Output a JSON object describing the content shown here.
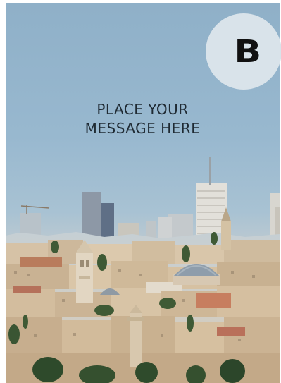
{
  "card": {
    "message_line1": "PLACE YOUR",
    "message_line2": "MESSAGE HERE",
    "badge_letter": "B"
  },
  "colors": {
    "sky": "#98b8cf",
    "badge_bg": "#d9e3ea",
    "text": "#1f2a33",
    "stone": "#d8c3a5",
    "roof": "#b9785a",
    "dome": "#8b9aa8"
  },
  "photo": {
    "subject": "jerusalem-cityscape-image"
  }
}
